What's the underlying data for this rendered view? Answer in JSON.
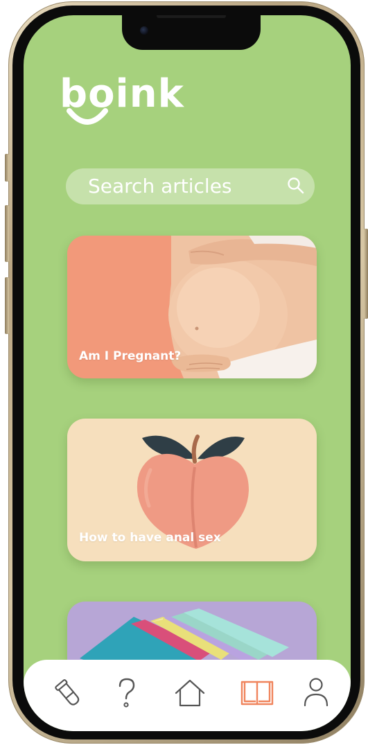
{
  "app": {
    "logo_text": "boink"
  },
  "search": {
    "placeholder": "Search articles",
    "icon": "search-icon"
  },
  "articles": [
    {
      "title": "Am I Pregnant?",
      "image": "pregnant-belly-photo"
    },
    {
      "title": "How to have anal sex",
      "image": "peach-illustration"
    },
    {
      "title": "",
      "image": "colorful-condom-wrappers-photo"
    }
  ],
  "bottom_nav": {
    "items": [
      {
        "icon": "test-tube-icon",
        "active": false
      },
      {
        "icon": "question-mark-icon",
        "active": false
      },
      {
        "icon": "home-icon",
        "active": false
      },
      {
        "icon": "open-book-icon",
        "active": true
      },
      {
        "icon": "user-icon",
        "active": false
      }
    ]
  },
  "colors": {
    "background": "#a6d17d",
    "search_bg": "#c6e1ab",
    "card_1": "#f2997a",
    "card_2": "#f6dfbd",
    "card_3": "#b7a6d6",
    "nav_active": "#f0845c",
    "nav_inactive": "#555555"
  }
}
